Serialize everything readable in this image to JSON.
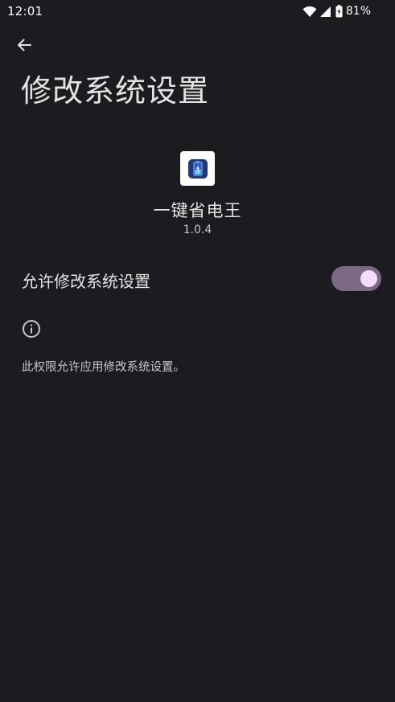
{
  "status_bar": {
    "time": "12:01",
    "battery_percent": "81%",
    "icons": [
      "wifi-icon",
      "signal-icon",
      "battery-icon"
    ]
  },
  "header": {
    "back_icon": "arrow-back-icon",
    "title": "修改系统设置"
  },
  "app": {
    "name": "一键省电王",
    "version": "1.0.4",
    "icon": "battery-app-icon"
  },
  "permission": {
    "label": "允许修改系统设置",
    "enabled": true
  },
  "info": {
    "icon": "info-icon",
    "description": "此权限允许应用修改系统设置。"
  },
  "colors": {
    "background": "#1c1b1f",
    "toggle_track": "#7b6985",
    "toggle_thumb": "#f3dcff",
    "text_primary": "#e6e1e5",
    "text_secondary": "#cac4d0"
  }
}
